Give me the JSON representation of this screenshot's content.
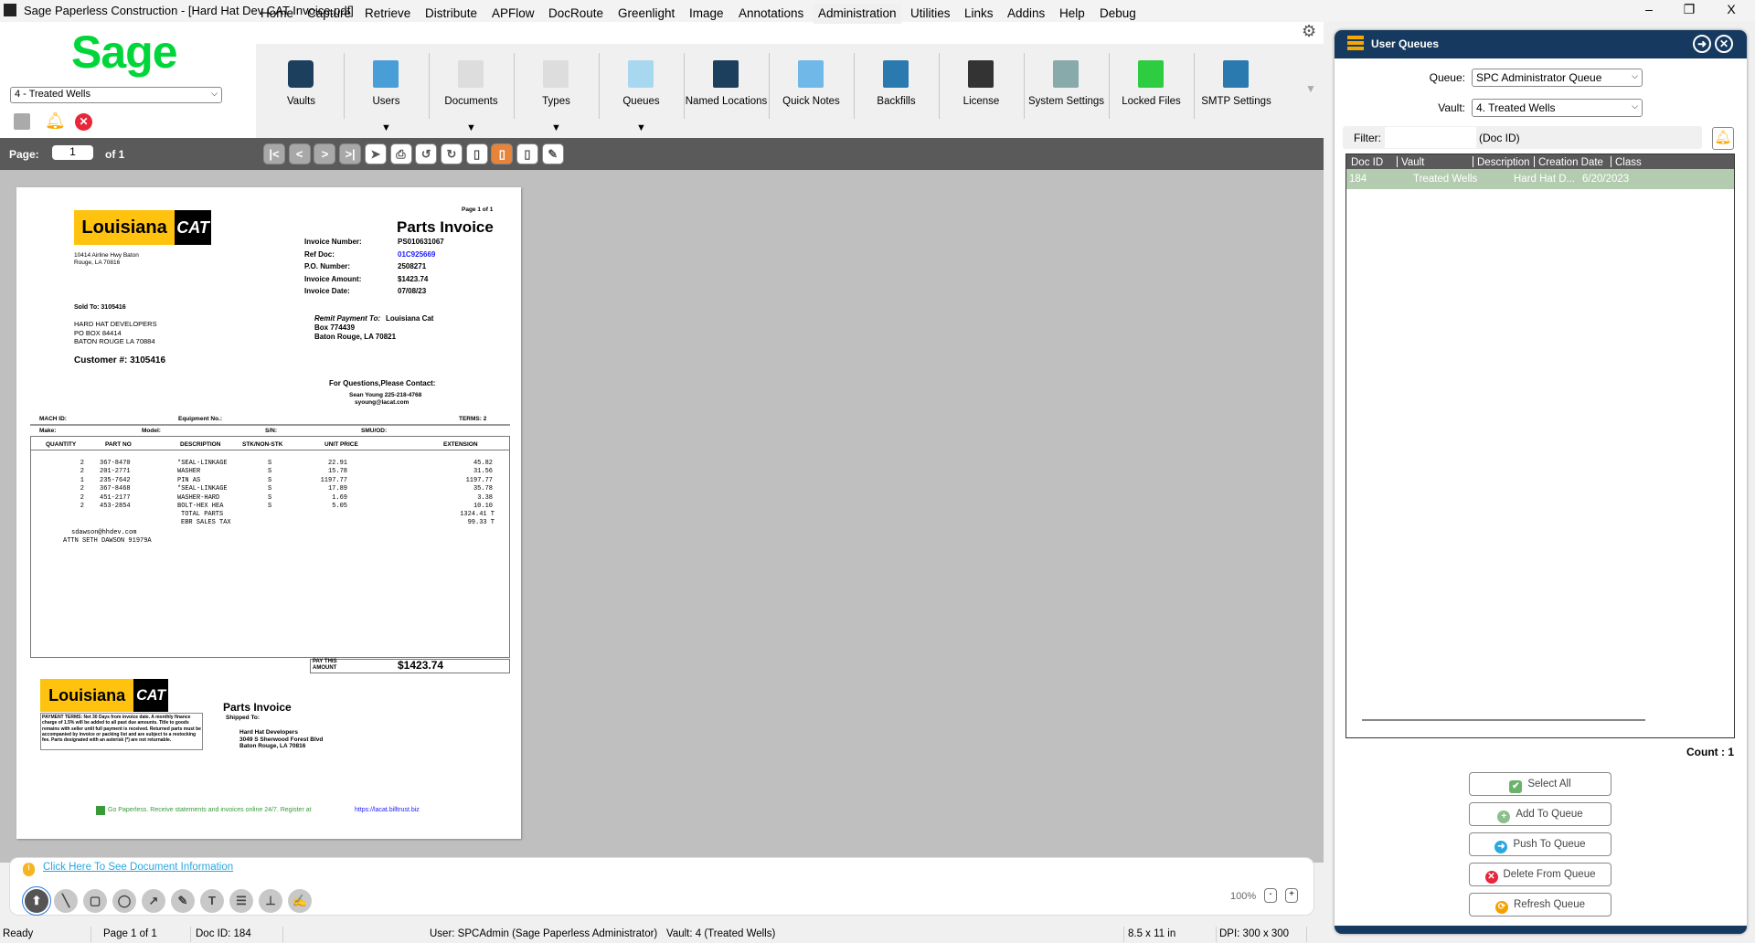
{
  "window": {
    "title": "Sage Paperless Construction - [Hard Hat Dev CAT Invoice.pdf]",
    "minimize": "–",
    "restore": "❐",
    "close": "X"
  },
  "logo": "Sage",
  "vault_select": "4 - Treated Wells",
  "menu": [
    "Home",
    "Capture",
    "Retrieve",
    "Distribute",
    "APFlow",
    "DocRoute",
    "Greenlight",
    "Image",
    "Annotations",
    "Administration",
    "Utilities",
    "Links",
    "Addins",
    "Help",
    "Debug"
  ],
  "active_menu": "Administration",
  "ribbon": [
    {
      "label": "Vaults",
      "icon": "vault-shield-icon",
      "dropdown": false
    },
    {
      "label": "Users",
      "icon": "users-icon",
      "dropdown": true
    },
    {
      "label": "Documents",
      "icon": "documents-icon",
      "dropdown": true
    },
    {
      "label": "Types",
      "icon": "types-icon",
      "dropdown": true
    },
    {
      "label": "Queues",
      "icon": "queues-icon",
      "dropdown": true
    },
    {
      "label": "Named Locations",
      "icon": "location-pin-icon",
      "dropdown": false
    },
    {
      "label": "Quick Notes",
      "icon": "quick-notes-icon",
      "dropdown": false
    },
    {
      "label": "Backfills",
      "icon": "backfills-icon",
      "dropdown": false
    },
    {
      "label": "License",
      "icon": "license-icon",
      "dropdown": false
    },
    {
      "label": "System Settings",
      "icon": "system-settings-icon",
      "dropdown": false
    },
    {
      "label": "Locked Files",
      "icon": "locked-files-icon",
      "dropdown": false
    },
    {
      "label": "SMTP Settings",
      "icon": "smtp-settings-icon",
      "dropdown": false
    }
  ],
  "pagebar": {
    "label": "Page:",
    "value": "1",
    "of": "of 1"
  },
  "invoice": {
    "page_of": "Page 1 of 1",
    "title": "Parts Invoice",
    "logo_text": "Louisiana",
    "logo_cat": "CAT",
    "address": [
      "10414 Airline Hwy Baton",
      "Rouge, LA 70816"
    ],
    "fields": [
      [
        "Invoice Number:",
        "PS010631067"
      ],
      [
        "Ref Doc:",
        "01C925669"
      ],
      [
        "P.O. Number:",
        "2508271"
      ],
      [
        "Invoice Amount:",
        "$1423.74"
      ],
      [
        "Invoice Date:",
        "07/08/23"
      ]
    ],
    "sold_to": "Sold To:  3105416",
    "bill_to": [
      "HARD HAT DEVELOPERS",
      "PO BOX 84414",
      "BATON ROUGE LA 70884"
    ],
    "customer": "Customer #:  3105416",
    "remit_label": "Remit Payment To:",
    "remit": [
      "Louisiana Cat",
      "Box 774439",
      "Baton Rouge, LA 70821"
    ],
    "contact": [
      "For Questions,Please Contact:",
      "Sean Young 225-218-4768",
      "syoung@lacat.com"
    ],
    "mach": [
      "MACH ID:",
      "Equipment No.:",
      "TERMS:  2"
    ],
    "make": [
      "Make:",
      "Model:",
      "S/N:",
      "SMU/OD:"
    ],
    "columns": [
      "QUANTITY",
      "PART NO",
      "DESCRIPTION",
      "STK/NON-STK",
      "UNIT PRICE",
      "EXTENSION"
    ],
    "lines": [
      [
        "2",
        "367-8470",
        "*SEAL-LINKAGE",
        "S",
        "22.91",
        "45.82"
      ],
      [
        "2",
        "201-2771",
        " WASHER",
        "S",
        "15.78",
        "31.56"
      ],
      [
        "1",
        "235-7642",
        " PIN AS",
        "S",
        "1197.77",
        "1197.77"
      ],
      [
        "2",
        "367-8468",
        "*SEAL-LINKAGE",
        "S",
        "17.89",
        "35.78"
      ],
      [
        "2",
        "451-2177",
        " WASHER-HARD",
        "S",
        "1.69",
        "3.38"
      ],
      [
        "2",
        "453-2854",
        " BOLT-HEX HEA",
        "S",
        "5.05",
        "10.10"
      ]
    ],
    "totals": [
      [
        "TOTAL PARTS",
        "1324.41 T"
      ],
      [
        "EBR SALES TAX",
        "99.33 T"
      ]
    ],
    "notes": [
      "sdawson@hhdev.com",
      "ATTN SETH DAWSON 91979A"
    ],
    "pay_label": [
      "PAY THIS",
      "AMOUNT"
    ],
    "pay_amount": "$1423.74",
    "payment_terms": "PAYMENT TERMS: Net 30 Days from invoice date. A monthly finance charge of 1.5% will be added to all past due amounts. Title to goods remains with seller until full payment is received. Returned parts must be accompanied by invoice or packing list and are subject to a restocking fee. Parts designated with an asterisk (*) are not returnable.",
    "shipped_label": "Shipped To:",
    "shipped": [
      "Hard Hat Developers",
      "3049 S Sherwood Forest Blvd",
      "Baton Rouge, LA 70816"
    ],
    "paperless": "Go Paperless.  Receive statements and invoices online 24/7.  Register at",
    "paperless_link": "https://lacat.billtrust.biz"
  },
  "annot": {
    "info_link": "Click Here To See Document Information",
    "zoom": "100%",
    "zoom_out": "-",
    "zoom_in": "+",
    "tools": [
      "pointer-icon",
      "line-icon",
      "rectangle-icon",
      "ellipse-icon",
      "arrow-icon",
      "highlighter-icon",
      "text-icon",
      "note-icon",
      "stamp-icon",
      "signature-icon"
    ]
  },
  "status": {
    "ready": "Ready",
    "page": "Page 1 of 1",
    "doc": "Doc ID: 184",
    "user": "User: SPCAdmin (Sage Paperless Administrator)",
    "vault": "Vault: 4 (Treated Wells)",
    "size": "8.5 x 11 in",
    "dpi": "DPI: 300 x 300"
  },
  "queues": {
    "title": "User Queues",
    "queue_label": "Queue:",
    "queue_value": "SPC Administrator Queue",
    "vault_label": "Vault:",
    "vault_value": "4. Treated Wells",
    "filter_label": "Filter:",
    "filter_value": "",
    "filter_hint": "(Doc ID)",
    "columns": [
      "Doc ID",
      "Vault",
      "Description",
      "Creation Date",
      "Class"
    ],
    "rows": [
      [
        "184",
        "Treated Wells",
        "Hard Hat D...",
        "6/20/2023",
        ""
      ]
    ],
    "count": "Count : 1",
    "buttons": [
      "Select All",
      "Add To Queue",
      "Push To Queue",
      "Delete From Queue",
      "Refresh Queue"
    ]
  },
  "colors": {
    "header": "#163a5f",
    "selected_row": "#b3ccb0",
    "accent": "#e8833a",
    "sage_green": "#00d639"
  }
}
